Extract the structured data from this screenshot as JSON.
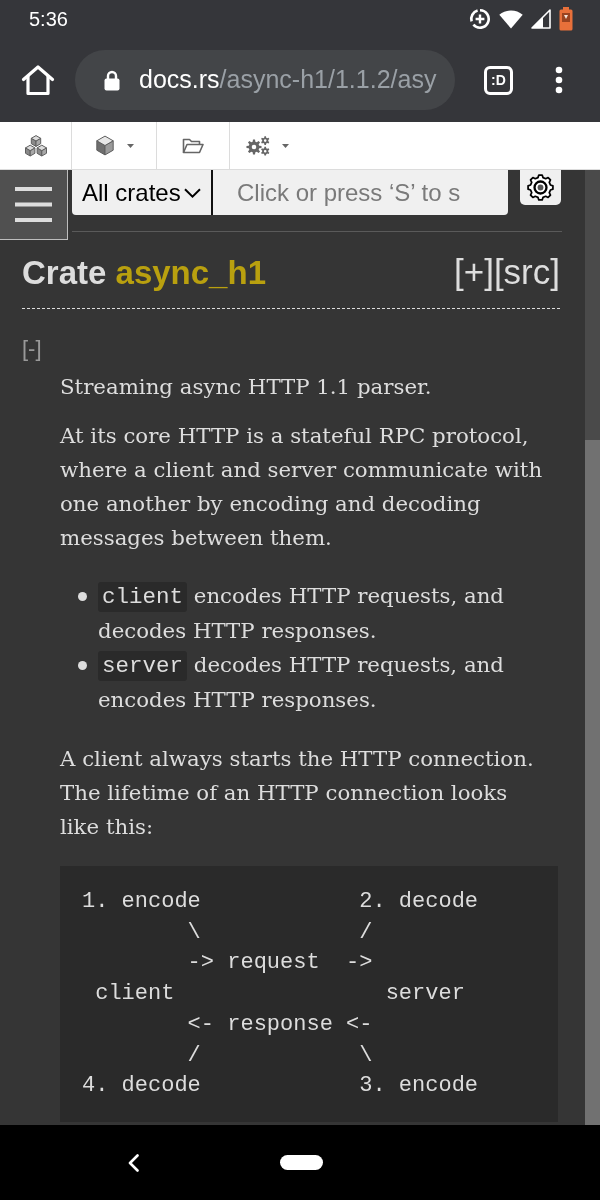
{
  "status_bar": {
    "time": "5:36"
  },
  "browser": {
    "url": {
      "host": "docs.rs",
      "path": "/async-h1/1.1.2/asy"
    },
    "tab_count": ":D"
  },
  "docs_nav": {
    "items": [
      {
        "kind": "crates",
        "dropdown": false
      },
      {
        "kind": "crate",
        "dropdown": true
      },
      {
        "kind": "source",
        "dropdown": false
      },
      {
        "kind": "tools",
        "dropdown": true
      }
    ]
  },
  "search": {
    "scope": "All crates",
    "placeholder": "Click or press ‘S’ to s"
  },
  "heading": {
    "label": "Crate",
    "name": "async_h1",
    "expand_toggle": "[+]",
    "source_link": "[src]"
  },
  "collapse_toggle": "[-]",
  "docblock": [
    {
      "kind": "paragraph",
      "text": "Streaming async HTTP 1.1 parser."
    },
    {
      "kind": "paragraph",
      "text": "At its core HTTP is a stateful RPC protocol, where a client and server communicate with one another by encoding and decoding messages between them."
    },
    {
      "kind": "list",
      "items": [
        {
          "code": "client",
          "text": "encodes HTTP requests, and decodes HTTP responses."
        },
        {
          "code": "server",
          "text": "decodes HTTP requests, and encodes HTTP responses."
        }
      ]
    },
    {
      "kind": "paragraph",
      "text": "A client always starts the HTTP connection. The lifetime of an HTTP connection looks like this:"
    },
    {
      "kind": "code",
      "text": "1. encode            2. decode\n        \\            /\n        -> request  ->\n client                server\n        <- response <-\n        /            \\\n4. decode            3. encode"
    }
  ]
}
